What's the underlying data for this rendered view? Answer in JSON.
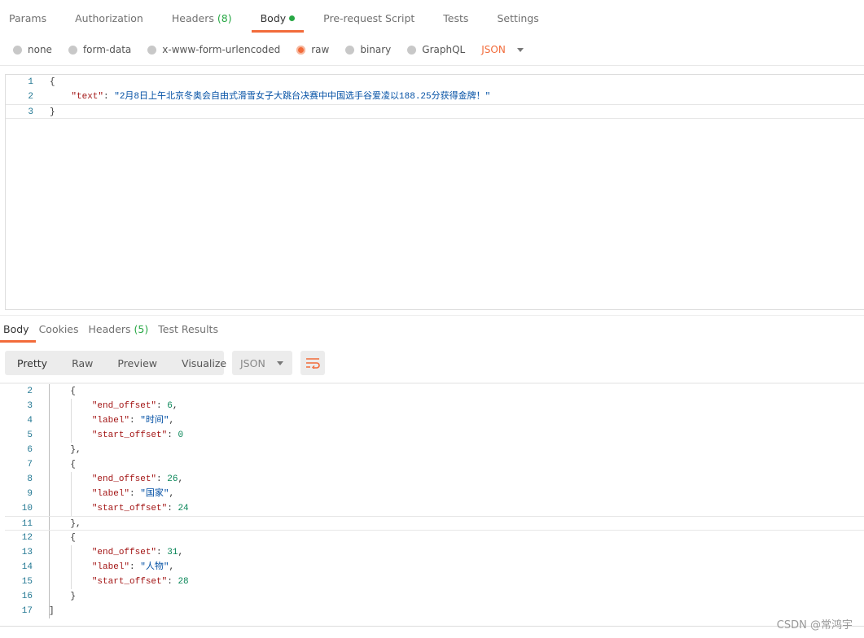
{
  "request_tabs": [
    {
      "label": "Params"
    },
    {
      "label": "Authorization"
    },
    {
      "label": "Headers",
      "count": "(8)"
    },
    {
      "label": "Body"
    },
    {
      "label": "Pre-request Script"
    },
    {
      "label": "Tests"
    },
    {
      "label": "Settings"
    }
  ],
  "body_types": [
    {
      "label": "none"
    },
    {
      "label": "form-data"
    },
    {
      "label": "x-www-form-urlencoded"
    },
    {
      "label": "raw"
    },
    {
      "label": "binary"
    },
    {
      "label": "GraphQL"
    }
  ],
  "selected_body_type": "raw",
  "raw_language": "JSON",
  "request_body": [
    {
      "n": "1",
      "tokens": [
        [
          "{",
          "p"
        ]
      ]
    },
    {
      "n": "2",
      "tokens": [
        [
          "    ",
          "p"
        ],
        [
          "\"text\"",
          "k"
        ],
        [
          ": ",
          "p"
        ],
        [
          "\"2月8日上午北京冬奥会自由式滑雪女子大跳台决赛中中国选手谷爱凌以188.25分获得金牌！\"",
          "s"
        ]
      ]
    },
    {
      "n": "3",
      "tokens": [
        [
          "}",
          "p"
        ]
      ]
    }
  ],
  "response_tabs": [
    {
      "label": "Body"
    },
    {
      "label": "Cookies"
    },
    {
      "label": "Headers",
      "count": "(5)"
    },
    {
      "label": "Test Results"
    }
  ],
  "view_modes": [
    "Pretty",
    "Raw",
    "Preview",
    "Visualize"
  ],
  "response_format": "JSON",
  "response_body": [
    {
      "n": "2",
      "tokens": [
        [
          "    {",
          "p"
        ]
      ]
    },
    {
      "n": "3",
      "tokens": [
        [
          "        ",
          "p"
        ],
        [
          "\"end_offset\"",
          "k"
        ],
        [
          ": ",
          "p"
        ],
        [
          "6",
          "n"
        ],
        [
          ",",
          "p"
        ]
      ]
    },
    {
      "n": "4",
      "tokens": [
        [
          "        ",
          "p"
        ],
        [
          "\"label\"",
          "k"
        ],
        [
          ": ",
          "p"
        ],
        [
          "\"时间\"",
          "s"
        ],
        [
          ",",
          "p"
        ]
      ]
    },
    {
      "n": "5",
      "tokens": [
        [
          "        ",
          "p"
        ],
        [
          "\"start_offset\"",
          "k"
        ],
        [
          ": ",
          "p"
        ],
        [
          "0",
          "n"
        ]
      ]
    },
    {
      "n": "6",
      "tokens": [
        [
          "    },",
          "p"
        ]
      ]
    },
    {
      "n": "7",
      "tokens": [
        [
          "    {",
          "p"
        ]
      ]
    },
    {
      "n": "8",
      "tokens": [
        [
          "        ",
          "p"
        ],
        [
          "\"end_offset\"",
          "k"
        ],
        [
          ": ",
          "p"
        ],
        [
          "26",
          "n"
        ],
        [
          ",",
          "p"
        ]
      ]
    },
    {
      "n": "9",
      "tokens": [
        [
          "        ",
          "p"
        ],
        [
          "\"label\"",
          "k"
        ],
        [
          ": ",
          "p"
        ],
        [
          "\"国家\"",
          "s"
        ],
        [
          ",",
          "p"
        ]
      ]
    },
    {
      "n": "10",
      "tokens": [
        [
          "        ",
          "p"
        ],
        [
          "\"start_offset\"",
          "k"
        ],
        [
          ": ",
          "p"
        ],
        [
          "24",
          "n"
        ]
      ]
    },
    {
      "n": "11",
      "tokens": [
        [
          "    },",
          "p"
        ]
      ]
    },
    {
      "n": "12",
      "tokens": [
        [
          "    {",
          "p"
        ]
      ]
    },
    {
      "n": "13",
      "tokens": [
        [
          "        ",
          "p"
        ],
        [
          "\"end_offset\"",
          "k"
        ],
        [
          ": ",
          "p"
        ],
        [
          "31",
          "n"
        ],
        [
          ",",
          "p"
        ]
      ]
    },
    {
      "n": "14",
      "tokens": [
        [
          "        ",
          "p"
        ],
        [
          "\"label\"",
          "k"
        ],
        [
          ": ",
          "p"
        ],
        [
          "\"人物\"",
          "s"
        ],
        [
          ",",
          "p"
        ]
      ]
    },
    {
      "n": "15",
      "tokens": [
        [
          "        ",
          "p"
        ],
        [
          "\"start_offset\"",
          "k"
        ],
        [
          ": ",
          "p"
        ],
        [
          "28",
          "n"
        ]
      ]
    },
    {
      "n": "16",
      "tokens": [
        [
          "    }",
          "p"
        ]
      ]
    },
    {
      "n": "17",
      "tokens": [
        [
          "]",
          "p"
        ]
      ]
    }
  ],
  "watermark": "CSDN @常鸿宇",
  "colors": {
    "accent": "#f26b3a",
    "count_green": "#27a744",
    "json_key": "#a31515",
    "json_string": "#0451a5",
    "json_number": "#098658"
  }
}
